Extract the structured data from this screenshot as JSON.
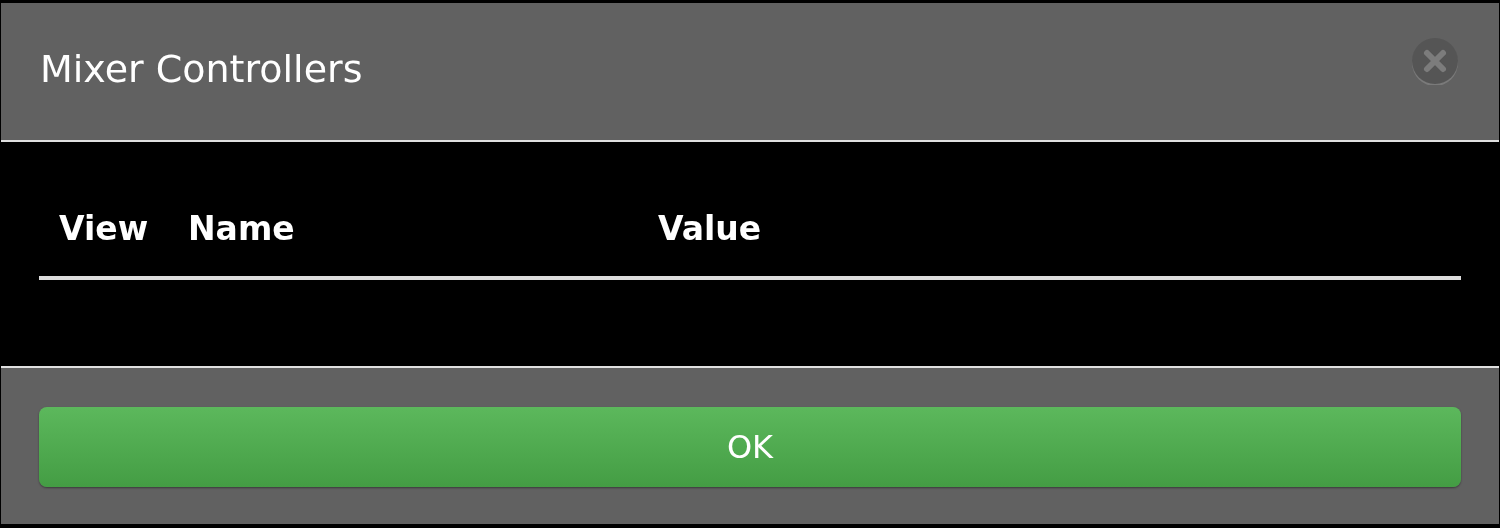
{
  "dialog": {
    "title": "Mixer Controllers"
  },
  "table": {
    "columns": [
      "View",
      "Name",
      "Value"
    ]
  },
  "buttons": [
    "OK"
  ]
}
